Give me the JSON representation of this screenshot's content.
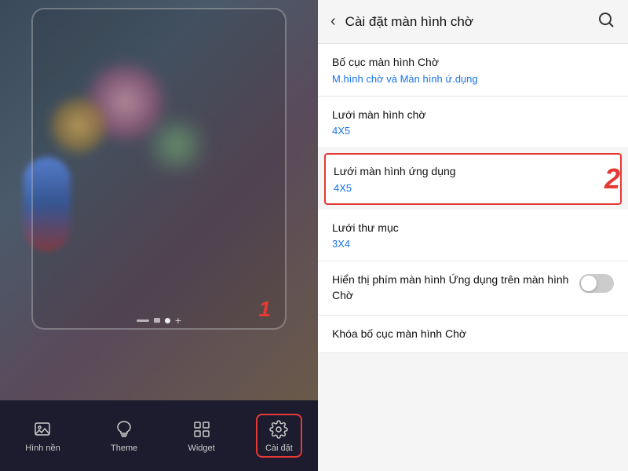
{
  "left": {
    "nav_items": [
      {
        "id": "hinh-nen",
        "label": "Hình nền",
        "icon": "image"
      },
      {
        "id": "theme",
        "label": "Theme",
        "icon": "theme"
      },
      {
        "id": "widget",
        "label": "Widget",
        "icon": "widget"
      },
      {
        "id": "cai-dat",
        "label": "Cài đặt",
        "icon": "settings",
        "active": true
      }
    ],
    "badge1": "1"
  },
  "right": {
    "header": {
      "title": "Cài đặt màn hình chờ",
      "back_label": "<",
      "search_label": "🔍"
    },
    "settings": [
      {
        "id": "bo-cuc",
        "title": "Bố cục màn hình Chờ",
        "value": "M.hình chờ và Màn hình ứ.dụng",
        "highlighted": false,
        "has_toggle": false
      },
      {
        "id": "luoi-man-hinh-cho",
        "title": "Lưới màn hình chờ",
        "value": "4X5",
        "highlighted": false,
        "has_toggle": false
      },
      {
        "id": "luoi-man-hinh-ung-dung",
        "title": "Lưới màn hình ứng dụng",
        "value": "4X5",
        "highlighted": true,
        "has_toggle": false
      },
      {
        "id": "luoi-thu-muc",
        "title": "Lưới thư mục",
        "value": "3X4",
        "highlighted": false,
        "has_toggle": false
      },
      {
        "id": "hien-thi-phim",
        "title": "Hiển thị phím màn hình Ứng dụng trên màn hình Chờ",
        "value": "",
        "highlighted": false,
        "has_toggle": true,
        "toggle_on": false
      },
      {
        "id": "khoa-bo-cuc",
        "title": "Khóa bố cục màn hình Chờ",
        "value": "",
        "highlighted": false,
        "has_toggle": false
      }
    ],
    "badge2": "2"
  }
}
